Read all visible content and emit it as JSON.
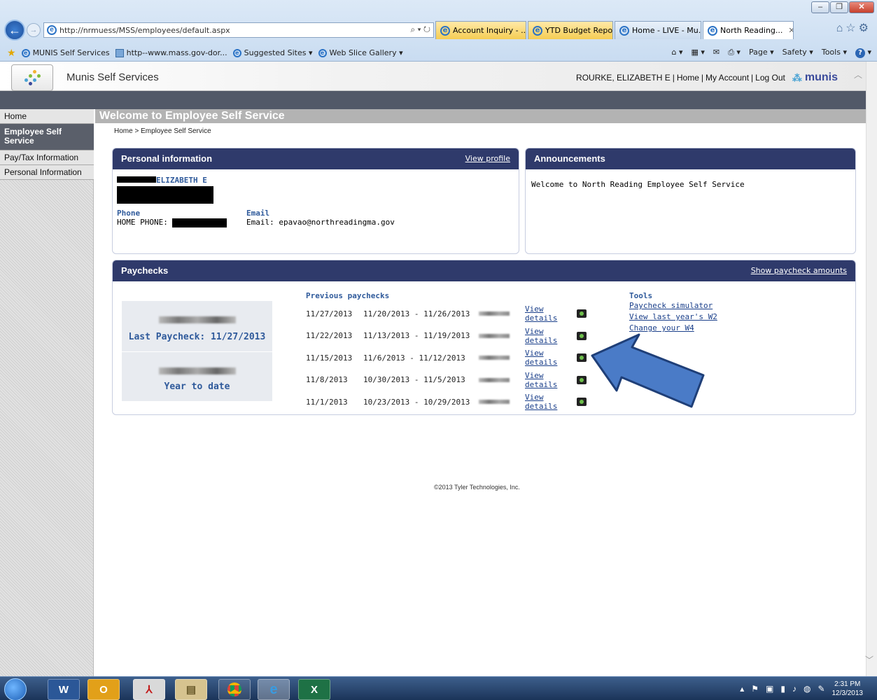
{
  "browser": {
    "address": "http://nrmuess/MSS/employees/default.aspx",
    "tabs": [
      {
        "label": "Account Inquiry - ...",
        "highlight": true
      },
      {
        "label": "YTD Budget Repo...",
        "highlight": true
      },
      {
        "label": "Home - LIVE - Mu...",
        "highlight": false
      },
      {
        "label": "North Reading...",
        "highlight": false,
        "active": true
      }
    ],
    "favorites": [
      "MUNIS Self Services",
      "http--www.mass.gov-dor...",
      "Suggested Sites ▾",
      "Web Slice Gallery ▾"
    ],
    "commands": [
      "Page ▾",
      "Safety ▾",
      "Tools ▾"
    ]
  },
  "header": {
    "app_title": "Munis Self Services",
    "user_name": "ROURKE, ELIZABETH E",
    "links": [
      "Home",
      "My Account",
      "Log Out"
    ],
    "brand": "munis"
  },
  "sidebar": {
    "items": [
      {
        "label": "Home",
        "active": false
      },
      {
        "label": "Employee Self Service",
        "active": true
      },
      {
        "label": "Pay/Tax Information",
        "active": false
      },
      {
        "label": "Personal Information",
        "active": false
      }
    ]
  },
  "main": {
    "heading": "Welcome to Employee Self Service",
    "breadcrumb": "Home > Employee Self Service"
  },
  "personal": {
    "title": "Personal information",
    "view_profile": "View profile",
    "name_visible": "ELIZABETH E",
    "phone_label": "Phone",
    "phone_value": "HOME PHONE:",
    "email_label": "Email",
    "email_value": "Email: epavao@northreadingma.gov"
  },
  "announcements": {
    "title": "Announcements",
    "text": "Welcome to North Reading Employee Self Service"
  },
  "paychecks": {
    "title": "Paychecks",
    "show_amounts": "Show paycheck amounts",
    "last_paycheck": "Last Paycheck: 11/27/2013",
    "year_to_date": "Year to date",
    "previous_title": "Previous paychecks",
    "rows": [
      {
        "date": "11/27/2013",
        "range": "11/20/2013 - 11/26/2013",
        "link": "View details"
      },
      {
        "date": "11/22/2013",
        "range": "11/13/2013 - 11/19/2013",
        "link": "View details"
      },
      {
        "date": "11/15/2013",
        "range": "11/6/2013 - 11/12/2013",
        "link": "View details"
      },
      {
        "date": "11/8/2013",
        "range": "10/30/2013 - 11/5/2013",
        "link": "View details"
      },
      {
        "date": "11/1/2013",
        "range": "10/23/2013 - 10/29/2013",
        "link": "View details"
      }
    ],
    "tools_title": "Tools",
    "tools": [
      "Paycheck simulator",
      "View last year's W2",
      "Change your W4"
    ]
  },
  "footer": "©2013 Tyler Technologies, Inc.",
  "taskbar": {
    "apps": [
      "word-icon",
      "outlook-icon",
      "acrobat-icon",
      "explorer-icon",
      "chrome-icon",
      "ie-icon",
      "excel-icon"
    ],
    "time": "2:31 PM",
    "date": "12/3/2013"
  },
  "colors": {
    "panel_header": "#2f3a6b",
    "link": "#1a3f8a",
    "accent_arrow": "#4a7bc7"
  }
}
